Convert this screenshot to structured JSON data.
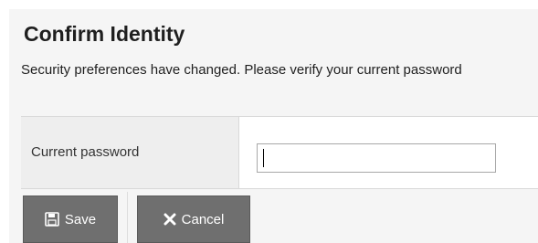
{
  "dialog": {
    "title": "Confirm Identity",
    "message": "Security preferences have changed. Please verify your current password"
  },
  "form": {
    "password_label": "Current password",
    "password_value": ""
  },
  "buttons": {
    "save": {
      "label": "Save",
      "icon": "floppy-disk-icon"
    },
    "cancel": {
      "label": "Cancel",
      "icon": "close-x-icon"
    }
  },
  "colors": {
    "button_bg": "#6f6f6f",
    "panel_bg": "#f5f5f5",
    "label_cell_bg": "#eeeeee"
  }
}
